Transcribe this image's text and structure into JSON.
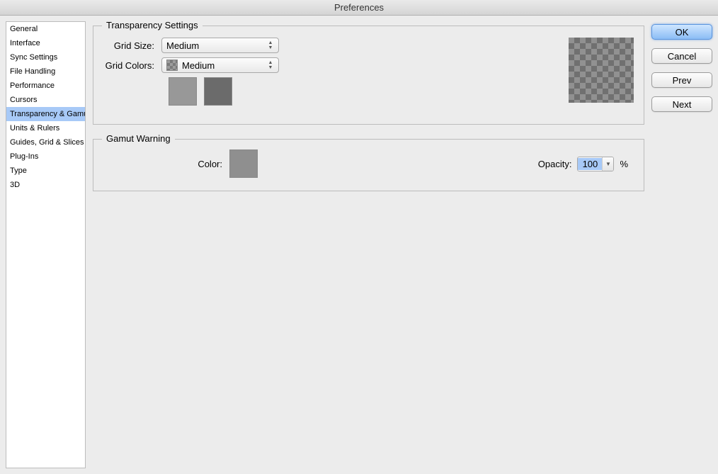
{
  "window": {
    "title": "Preferences"
  },
  "sidebar": {
    "items": [
      {
        "label": "General"
      },
      {
        "label": "Interface"
      },
      {
        "label": "Sync Settings"
      },
      {
        "label": "File Handling"
      },
      {
        "label": "Performance"
      },
      {
        "label": "Cursors"
      },
      {
        "label": "Transparency & Gamut"
      },
      {
        "label": "Units & Rulers"
      },
      {
        "label": "Guides, Grid & Slices"
      },
      {
        "label": "Plug-Ins"
      },
      {
        "label": "Type"
      },
      {
        "label": "3D"
      }
    ],
    "active_index": 6
  },
  "transparency": {
    "legend": "Transparency Settings",
    "grid_size_label": "Grid Size:",
    "grid_size_value": "Medium",
    "grid_colors_label": "Grid Colors:",
    "grid_colors_value": "Medium",
    "swatch_light": "#989898",
    "swatch_dark": "#6b6b6b"
  },
  "gamut": {
    "legend": "Gamut Warning",
    "color_label": "Color:",
    "color_value": "#8f8f8f",
    "opacity_label": "Opacity:",
    "opacity_value": "100",
    "opacity_unit": "%"
  },
  "buttons": {
    "ok": "OK",
    "cancel": "Cancel",
    "prev": "Prev",
    "next": "Next"
  }
}
